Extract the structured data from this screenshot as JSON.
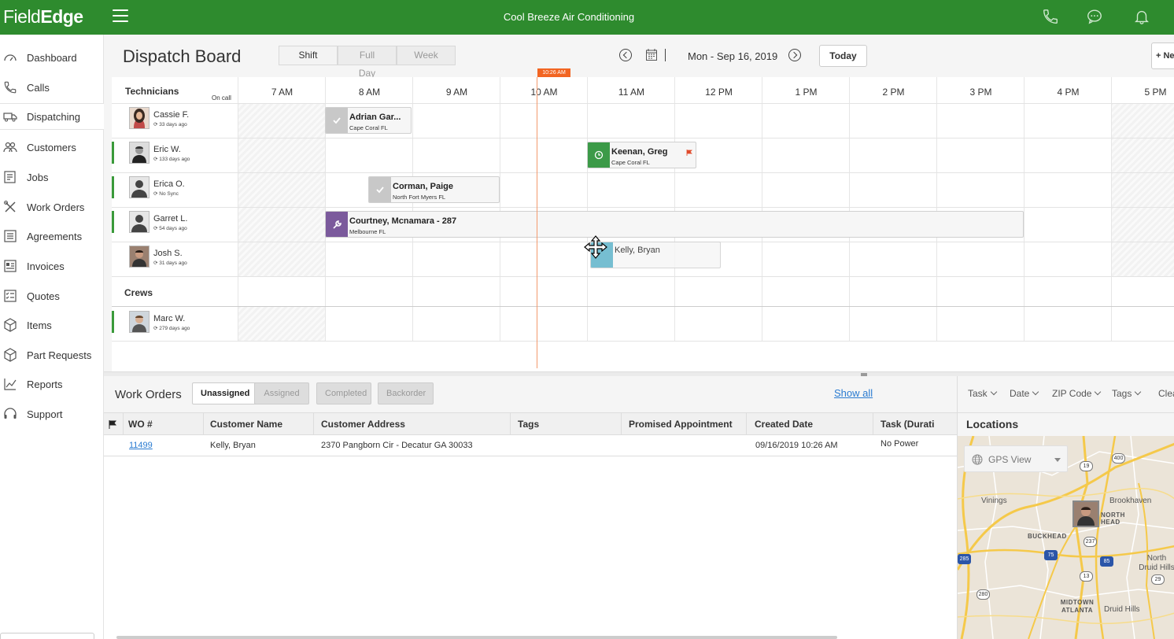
{
  "app": {
    "logo_field": "Field",
    "logo_edge": "Edge",
    "company": "Cool Breeze Air Conditioning"
  },
  "icons": {
    "menu": "hamburger-menu-icon",
    "phone": "phone-icon",
    "chat": "chat-bubble-icon",
    "bell": "bell-icon"
  },
  "sidebar": {
    "items": [
      {
        "label": "Dashboard",
        "icon": "speedometer-icon"
      },
      {
        "label": "Calls",
        "icon": "phone-icon"
      },
      {
        "label": "Dispatching",
        "icon": "truck-icon",
        "active": true
      },
      {
        "label": "Customers",
        "icon": "people-icon"
      },
      {
        "label": "Jobs",
        "icon": "clipboard-icon"
      },
      {
        "label": "Work Orders",
        "icon": "tools-icon"
      },
      {
        "label": "Agreements",
        "icon": "document-icon"
      },
      {
        "label": "Invoices",
        "icon": "invoice-icon"
      },
      {
        "label": "Quotes",
        "icon": "checklist-icon"
      },
      {
        "label": "Items",
        "icon": "box-icon"
      },
      {
        "label": "Part Requests",
        "icon": "package-icon"
      },
      {
        "label": "Reports",
        "icon": "chart-line-icon"
      },
      {
        "label": "Support",
        "icon": "headset-icon"
      }
    ]
  },
  "header": {
    "title": "Dispatch Board",
    "views": [
      "Shift",
      "Full Day",
      "Week"
    ],
    "active_view": "Shift",
    "date": "Mon - Sep 16, 2019",
    "today_label": "Today",
    "new_label": "+ Ne"
  },
  "schedule": {
    "technicians_label": "Technicians",
    "oncall_label": "On call",
    "crews_label": "Crews",
    "current_time": "10:26 AM",
    "hours": [
      "7 AM",
      "8 AM",
      "9 AM",
      "10 AM",
      "11 AM",
      "12 PM",
      "1 PM",
      "2 PM",
      "3 PM",
      "4 PM",
      "5 PM"
    ],
    "technicians": [
      {
        "name": "Cassie F.",
        "sync": "33 days ago"
      },
      {
        "name": "Eric W.",
        "sync": "133 days ago"
      },
      {
        "name": "Erica O.",
        "sync": "No Sync"
      },
      {
        "name": "Garret L.",
        "sync": "54 days ago"
      },
      {
        "name": "Josh S.",
        "sync": "31 days ago"
      }
    ],
    "crews": [
      {
        "name": "Marc W.",
        "sync": "279 days ago"
      }
    ],
    "jobs": [
      {
        "title": "Adrian Gar...",
        "location": "Cape Coral FL",
        "status": "completed",
        "color": "#c8c8c8"
      },
      {
        "title": "Keenan, Greg",
        "location": "Cape Coral FL",
        "status": "in-progress",
        "color": "#3c9a48"
      },
      {
        "title": "Corman, Paige",
        "location": "North Fort Myers FL",
        "status": "completed",
        "color": "#c8c8c8"
      },
      {
        "title": "Courtney, Mcnamara - 287",
        "location": "Melbourne FL",
        "status": "working",
        "color": "#7b5a9c"
      },
      {
        "title": "Kelly, Bryan",
        "location": "",
        "status": "dragging",
        "color": "#5fb3c9"
      }
    ]
  },
  "work_orders": {
    "title": "Work Orders",
    "tabs": [
      "Unassigned",
      "Assigned",
      "Completed",
      "Backorder"
    ],
    "active_tab": "Unassigned",
    "show_all": "Show all",
    "columns": [
      "WO #",
      "Customer Name",
      "Customer Address",
      "Tags",
      "Promised Appointment",
      "Created Date",
      "Task (Durati"
    ],
    "rows": [
      {
        "wo": "11499",
        "customer": "Kelly, Bryan",
        "address": "2370 Pangborn Cir - Decatur GA 30033",
        "tags": "",
        "promised": "",
        "created": "09/16/2019 10:26 AM",
        "task": "No Power"
      }
    ]
  },
  "filters": {
    "items": [
      "Task",
      "Date",
      "ZIP Code",
      "Tags",
      "Clea"
    ]
  },
  "locations": {
    "title": "Locations",
    "gps_label": "GPS View",
    "places": [
      "Vinings",
      "Brookhaven",
      "BUCKHEAD",
      "North Druid Hills",
      "MIDTOWN ATLANTA",
      "Druid Hills",
      "NORTH HEAD"
    ],
    "shields": [
      "400",
      "19",
      "237",
      "75",
      "85",
      "285",
      "13",
      "280",
      "29"
    ]
  },
  "colors": {
    "brand_green": "#2e8b2e",
    "now_marker": "#f26522",
    "link": "#2a7bd1"
  }
}
